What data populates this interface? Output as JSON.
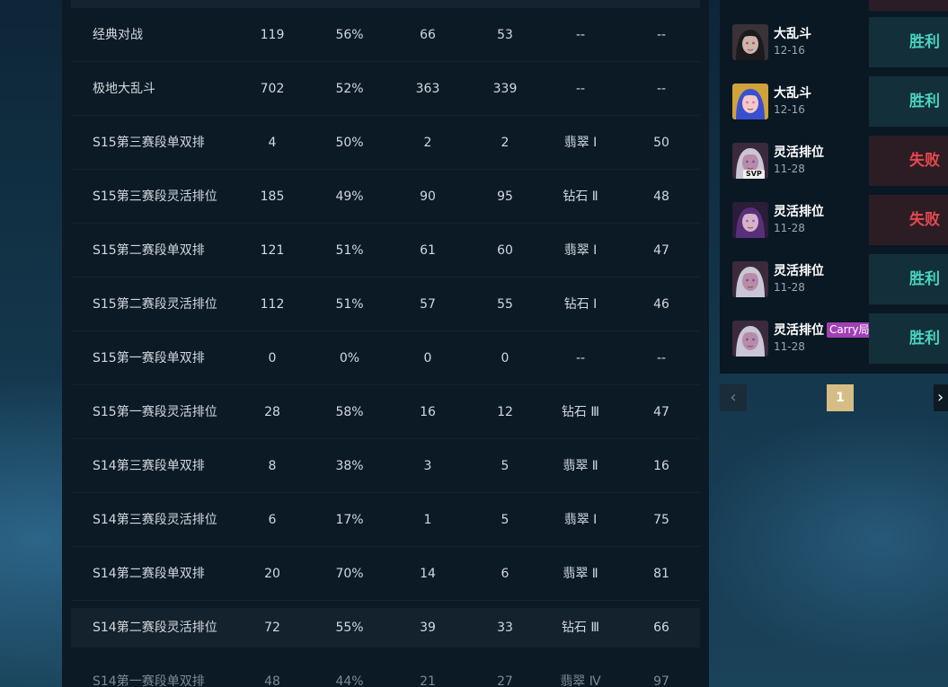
{
  "stats": {
    "rows": [
      {
        "name": "经典对战",
        "total": "119",
        "rate": "56%",
        "win": "66",
        "loss": "53",
        "tier": "--",
        "points": "--"
      },
      {
        "name": "极地大乱斗",
        "total": "702",
        "rate": "52%",
        "win": "363",
        "loss": "339",
        "tier": "--",
        "points": "--"
      },
      {
        "name": "S15第三赛段单双排",
        "total": "4",
        "rate": "50%",
        "win": "2",
        "loss": "2",
        "tier": "翡翠 Ⅰ",
        "points": "50"
      },
      {
        "name": "S15第三赛段灵活排位",
        "total": "185",
        "rate": "49%",
        "win": "90",
        "loss": "95",
        "tier": "钻石 Ⅱ",
        "points": "48"
      },
      {
        "name": "S15第二赛段单双排",
        "total": "121",
        "rate": "51%",
        "win": "61",
        "loss": "60",
        "tier": "翡翠 Ⅰ",
        "points": "47"
      },
      {
        "name": "S15第二赛段灵活排位",
        "total": "112",
        "rate": "51%",
        "win": "57",
        "loss": "55",
        "tier": "钻石 Ⅰ",
        "points": "46"
      },
      {
        "name": "S15第一赛段单双排",
        "total": "0",
        "rate": "0%",
        "win": "0",
        "loss": "0",
        "tier": "--",
        "points": "--"
      },
      {
        "name": "S15第一赛段灵活排位",
        "total": "28",
        "rate": "58%",
        "win": "16",
        "loss": "12",
        "tier": "钻石 Ⅲ",
        "points": "47"
      },
      {
        "name": "S14第三赛段单双排",
        "total": "8",
        "rate": "38%",
        "win": "3",
        "loss": "5",
        "tier": "翡翠 Ⅱ",
        "points": "16"
      },
      {
        "name": "S14第三赛段灵活排位",
        "total": "6",
        "rate": "17%",
        "win": "1",
        "loss": "5",
        "tier": "翡翠 Ⅰ",
        "points": "75"
      },
      {
        "name": "S14第二赛段单双排",
        "total": "20",
        "rate": "70%",
        "win": "14",
        "loss": "6",
        "tier": "翡翠 Ⅱ",
        "points": "81"
      },
      {
        "name": "S14第二赛段灵活排位",
        "total": "72",
        "rate": "55%",
        "win": "39",
        "loss": "33",
        "tier": "钻石 Ⅲ",
        "points": "66"
      },
      {
        "name": "S14第一赛段单双排",
        "total": "48",
        "rate": "44%",
        "win": "21",
        "loss": "27",
        "tier": "翡翠 Ⅳ",
        "points": "97"
      }
    ]
  },
  "history": {
    "matches": [
      {
        "mode": "大乱斗",
        "date": "12-16",
        "result": "胜利",
        "status": "win",
        "champion_icon": "dark-armored-champion-icon"
      },
      {
        "mode": "大乱斗",
        "date": "12-16",
        "result": "胜利",
        "status": "win",
        "champion_icon": "blue-haired-champion-icon"
      },
      {
        "mode": "灵活排位",
        "date": "11-28",
        "result": "失败",
        "status": "lose",
        "champion_icon": "silver-haired-champion-icon",
        "badge": "SVP"
      },
      {
        "mode": "灵活排位",
        "date": "11-28",
        "result": "失败",
        "status": "lose",
        "champion_icon": "purple-haired-champion-icon"
      },
      {
        "mode": "灵活排位",
        "date": "11-28",
        "result": "胜利",
        "status": "win",
        "champion_icon": "silver-haired-champion-icon"
      },
      {
        "mode": "灵活排位",
        "date": "11-28",
        "result": "胜利",
        "status": "win",
        "champion_icon": "silver-haired-champion-icon",
        "tag": "Carry局"
      }
    ],
    "colors": {
      "win": "#49d3c1",
      "lose": "#e5484d",
      "carry_badge": "#a23fb5"
    }
  },
  "pagination": {
    "current_page": "1",
    "prev_icon": "chevron-left-icon",
    "next_icon": "chevron-right-icon"
  }
}
